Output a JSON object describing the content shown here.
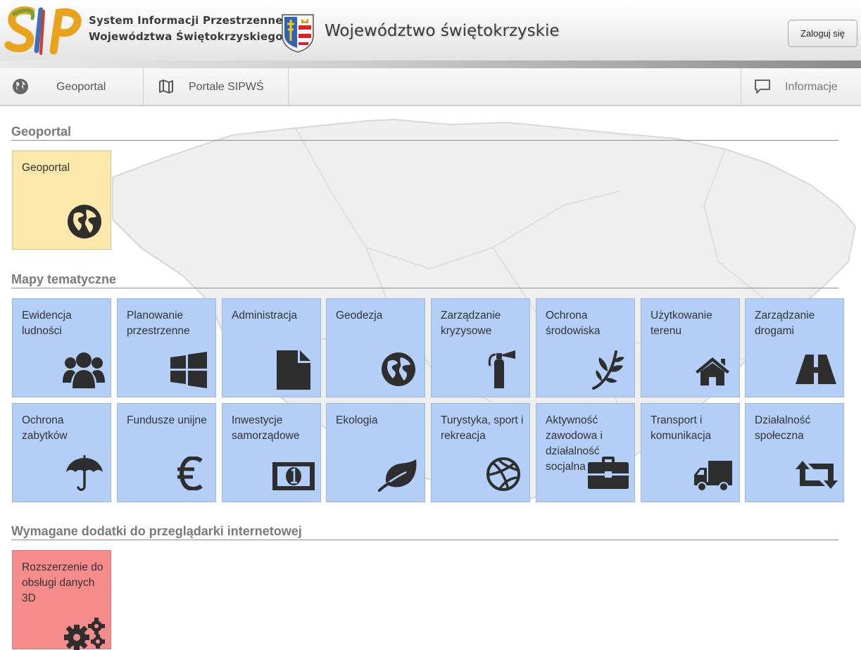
{
  "header": {
    "system_line1": "System Informacji Przestrzennej",
    "system_line2": "Województwa Świętokrzyskiego",
    "region_title": "Województwo świętokrzyskie",
    "login_label": "Zaloguj się"
  },
  "nav": {
    "items": [
      {
        "label": "Geoportal",
        "icon": "globe-icon"
      },
      {
        "label": "Portale SIPWŚ",
        "icon": "map-icon"
      }
    ],
    "info_label": "Informacje"
  },
  "sections": {
    "geoportal": {
      "title": "Geoportal",
      "tiles": [
        {
          "label": "Geoportal",
          "icon": "globe-americas-icon",
          "color": "#fde8ab"
        }
      ]
    },
    "thematic": {
      "title": "Mapy tematyczne",
      "tiles": [
        {
          "label": "Ewidencja ludności",
          "icon": "users-icon"
        },
        {
          "label": "Planowanie przestrzenne",
          "icon": "windows-icon"
        },
        {
          "label": "Administracja",
          "icon": "document-icon"
        },
        {
          "label": "Geodezja",
          "icon": "globe-americas-icon"
        },
        {
          "label": "Zarządzanie kryzysowe",
          "icon": "fire-extinguisher-icon"
        },
        {
          "label": "Ochrona środowiska",
          "icon": "plant-icon"
        },
        {
          "label": "Użytkowanie terenu",
          "icon": "house-icon"
        },
        {
          "label": "Zarządzanie drogami",
          "icon": "road-icon"
        },
        {
          "label": "Ochrona zabytków",
          "icon": "umbrella-icon"
        },
        {
          "label": "Fundusze unijne",
          "icon": "euro-icon"
        },
        {
          "label": "Inwestycje samorządowe",
          "icon": "banknote-icon"
        },
        {
          "label": "Ekologia",
          "icon": "leaf-icon"
        },
        {
          "label": "Turystyka, sport i rekreacja",
          "icon": "ball-icon"
        },
        {
          "label": "Aktywność zawodowa i działalność socjalna",
          "icon": "briefcase-icon"
        },
        {
          "label": "Transport i komunikacja",
          "icon": "truck-icon"
        },
        {
          "label": "Działalność społeczna",
          "icon": "retweet-icon"
        }
      ],
      "color": "#b3cff7"
    },
    "addons": {
      "title": "Wymagane dodatki do przeglądarki internetowej",
      "tiles": [
        {
          "label": "Rozszerzenie do obsługi danych 3D",
          "icon": "gears-icon",
          "color": "#f58b8b"
        }
      ]
    }
  },
  "colors": {
    "tile_blue": "#b3cff7",
    "tile_yellow": "#fde8ab",
    "tile_red": "#f58b8b",
    "icon_dark": "#2e2e2e",
    "section_title": "#7a7a7a"
  }
}
